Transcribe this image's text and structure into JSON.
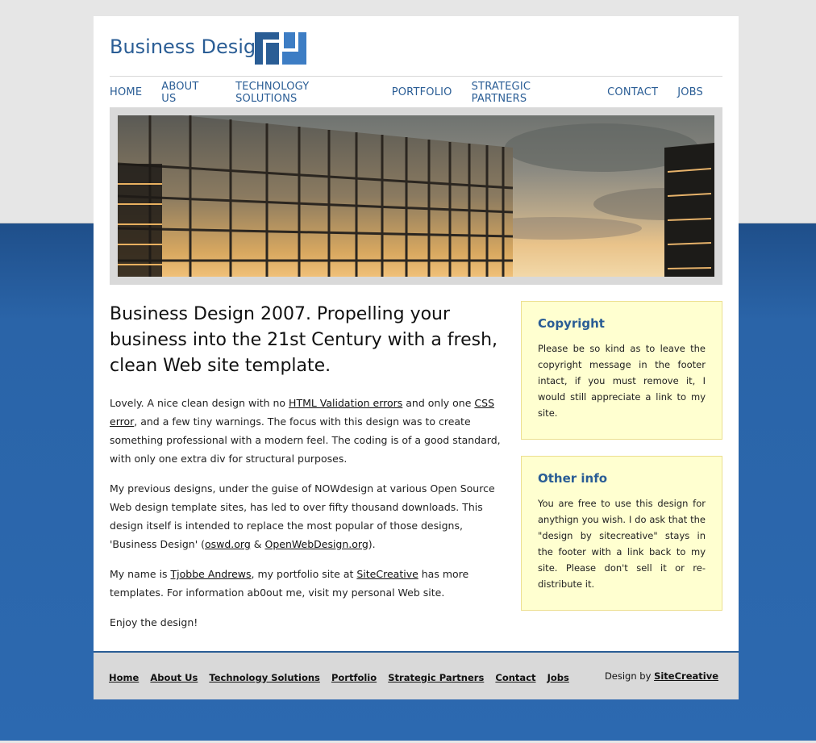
{
  "header": {
    "site_title": "Business Design"
  },
  "nav": {
    "items": [
      {
        "label": "HOME"
      },
      {
        "label": "ABOUT US"
      },
      {
        "label": "TECHNOLOGY SOLUTIONS"
      },
      {
        "label": "PORTFOLIO"
      },
      {
        "label": "STRATEGIC PARTNERS"
      },
      {
        "label": "CONTACT"
      },
      {
        "label": "JOBS"
      }
    ]
  },
  "main": {
    "heading": "Business Design 2007. Propelling your business into the 21st Century with a fresh, clean Web site template.",
    "p1": {
      "t1": "Lovely. A nice clean design with no ",
      "link1": "HTML Validation errors",
      "t2": " and only one ",
      "link2": "CSS error",
      "t3": ", and a few tiny warnings. The focus with this design was to create something professional with a modern feel. The coding is of a good standard, with only one extra div for structural purposes."
    },
    "p2": {
      "t1": "My previous designs, under the guise of NOWdesign at various Open Source Web design template sites, has led to over fifty thousand downloads. This design itself is intended to replace the most popular of those designs, 'Business Design' (",
      "link1": "oswd.org",
      "t2": " & ",
      "link2": "OpenWebDesign.org",
      "t3": ")."
    },
    "p3": {
      "t1": "My name is ",
      "link1": "Tjobbe Andrews",
      "t2": ", my portfolio site at ",
      "link2": "SiteCreative",
      "t3": " has more templates. For information ab0out me, visit my personal Web site."
    },
    "p4": "Enjoy the design!"
  },
  "sidebar": {
    "copyright": {
      "title": "Copyright",
      "text": "Please be so kind as to leave the copyright message in the footer intact, if you must remove it, I would still appreciate a link to my site."
    },
    "other": {
      "title": "Other info",
      "text": "You are free to use this design for anythign you wish. I do ask that the \"design by sitecreative\" stays in the footer with a link back to my site. Please don't sell it or re-distribute it."
    }
  },
  "footer": {
    "links": [
      {
        "label": "Home"
      },
      {
        "label": "About Us"
      },
      {
        "label": "Technology Solutions"
      },
      {
        "label": "Portfolio"
      },
      {
        "label": "Strategic Partners"
      },
      {
        "label": "Contact"
      },
      {
        "label": "Jobs"
      }
    ],
    "credit_prefix": "Design by ",
    "credit_link": "SiteCreative"
  },
  "colors": {
    "brand_blue": "#2a5d95",
    "box_bg": "#ffffd0",
    "background_blue": "#2a64a8"
  }
}
